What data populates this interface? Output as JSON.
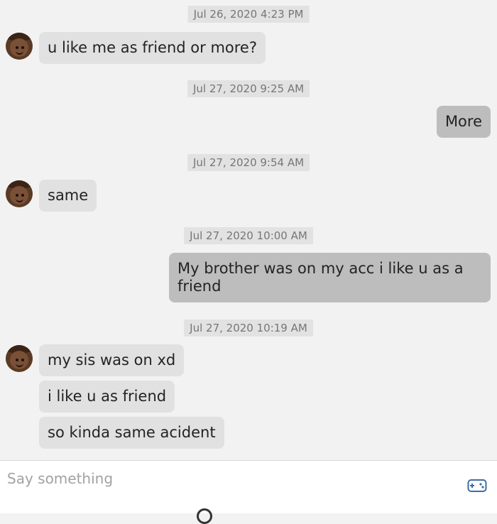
{
  "messages": [
    {
      "type": "timestamp",
      "text": "Jul 26, 2020 4:23 PM"
    },
    {
      "type": "incoming",
      "text": "u like me as friend or more?"
    },
    {
      "type": "timestamp",
      "text": "Jul 27, 2020 9:25 AM"
    },
    {
      "type": "outgoing",
      "text": "More"
    },
    {
      "type": "timestamp",
      "text": "Jul 27, 2020 9:54 AM"
    },
    {
      "type": "incoming",
      "text": "same"
    },
    {
      "type": "timestamp",
      "text": "Jul 27, 2020 10:00 AM"
    },
    {
      "type": "outgoing",
      "text": "My brother was on my acc i like u as a friend"
    },
    {
      "type": "timestamp",
      "text": "Jul 27, 2020 10:19 AM"
    },
    {
      "type": "incoming",
      "text": "my sis was on xd"
    },
    {
      "type": "incoming",
      "text": "i like u as friend"
    },
    {
      "type": "incoming",
      "text": "so kinda same acident"
    }
  ],
  "composer": {
    "placeholder": "Say something",
    "icon": "gamepad-icon"
  },
  "colors": {
    "background": "#f2f2f2",
    "incoming_bubble": "#e1e1e1",
    "outgoing_bubble": "#bdbdbd",
    "timestamp_bg": "#e2e2e2",
    "timestamp_text": "#767676"
  }
}
